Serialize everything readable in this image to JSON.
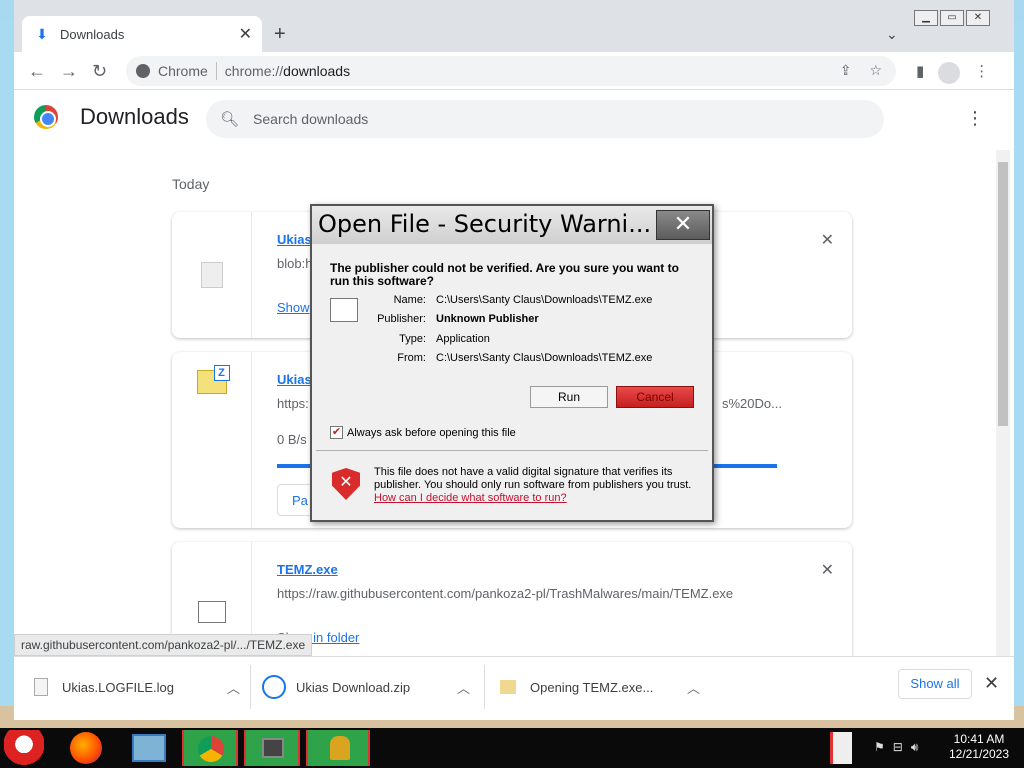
{
  "browser": {
    "tab_title": "Downloads",
    "omnibox_site": "Chrome",
    "url_prefix": "chrome://",
    "url_main": "downloads"
  },
  "page": {
    "title": "Downloads",
    "search_placeholder": "Search downloads",
    "section": "Today",
    "items": [
      {
        "name": "Ukias",
        "url": "blob:h",
        "action": "Show"
      },
      {
        "name": "Ukias",
        "url": "https:",
        "url_tail": "s%20Do...",
        "speed": "0 B/s",
        "button": "Pa"
      },
      {
        "name": "TEMZ.exe",
        "url": "https://raw.githubusercontent.com/pankoza2-pl/TrashMalwares/main/TEMZ.exe",
        "action": "Show in folder"
      }
    ]
  },
  "status_url": "raw.githubusercontent.com/pankoza2-pl/.../TEMZ.exe",
  "shelf": {
    "items": [
      {
        "label": "Ukias.LOGFILE.log"
      },
      {
        "label": "Ukias Download.zip"
      },
      {
        "label": "Opening TEMZ.exe..."
      }
    ],
    "show_all": "Show all"
  },
  "dialog": {
    "title": "Open File - Security Warni...",
    "question": "The publisher could not be verified.  Are you sure you want to run this software?",
    "fields": [
      {
        "label": "Name:",
        "value": "C:\\Users\\Santy Claus\\Downloads\\TEMZ.exe"
      },
      {
        "label": "Publisher:",
        "value": "Unknown Publisher"
      },
      {
        "label": "Type:",
        "value": "Application"
      },
      {
        "label": "From:",
        "value": "C:\\Users\\Santy Claus\\Downloads\\TEMZ.exe"
      }
    ],
    "run": "Run",
    "cancel": "Cancel",
    "checkbox": "Always ask before opening this file",
    "warning": "This file does not have a valid digital signature that verifies its publisher.  You should only run software from publishers you trust.",
    "link": "How can I decide what software to run?"
  },
  "taskbar": {
    "time": "10:41 AM",
    "date": "12/21/2023"
  },
  "colors": {
    "accent": "#1a73e8",
    "cancel_red": "#d42a2a",
    "taskbar_active": "#2fa34a"
  }
}
